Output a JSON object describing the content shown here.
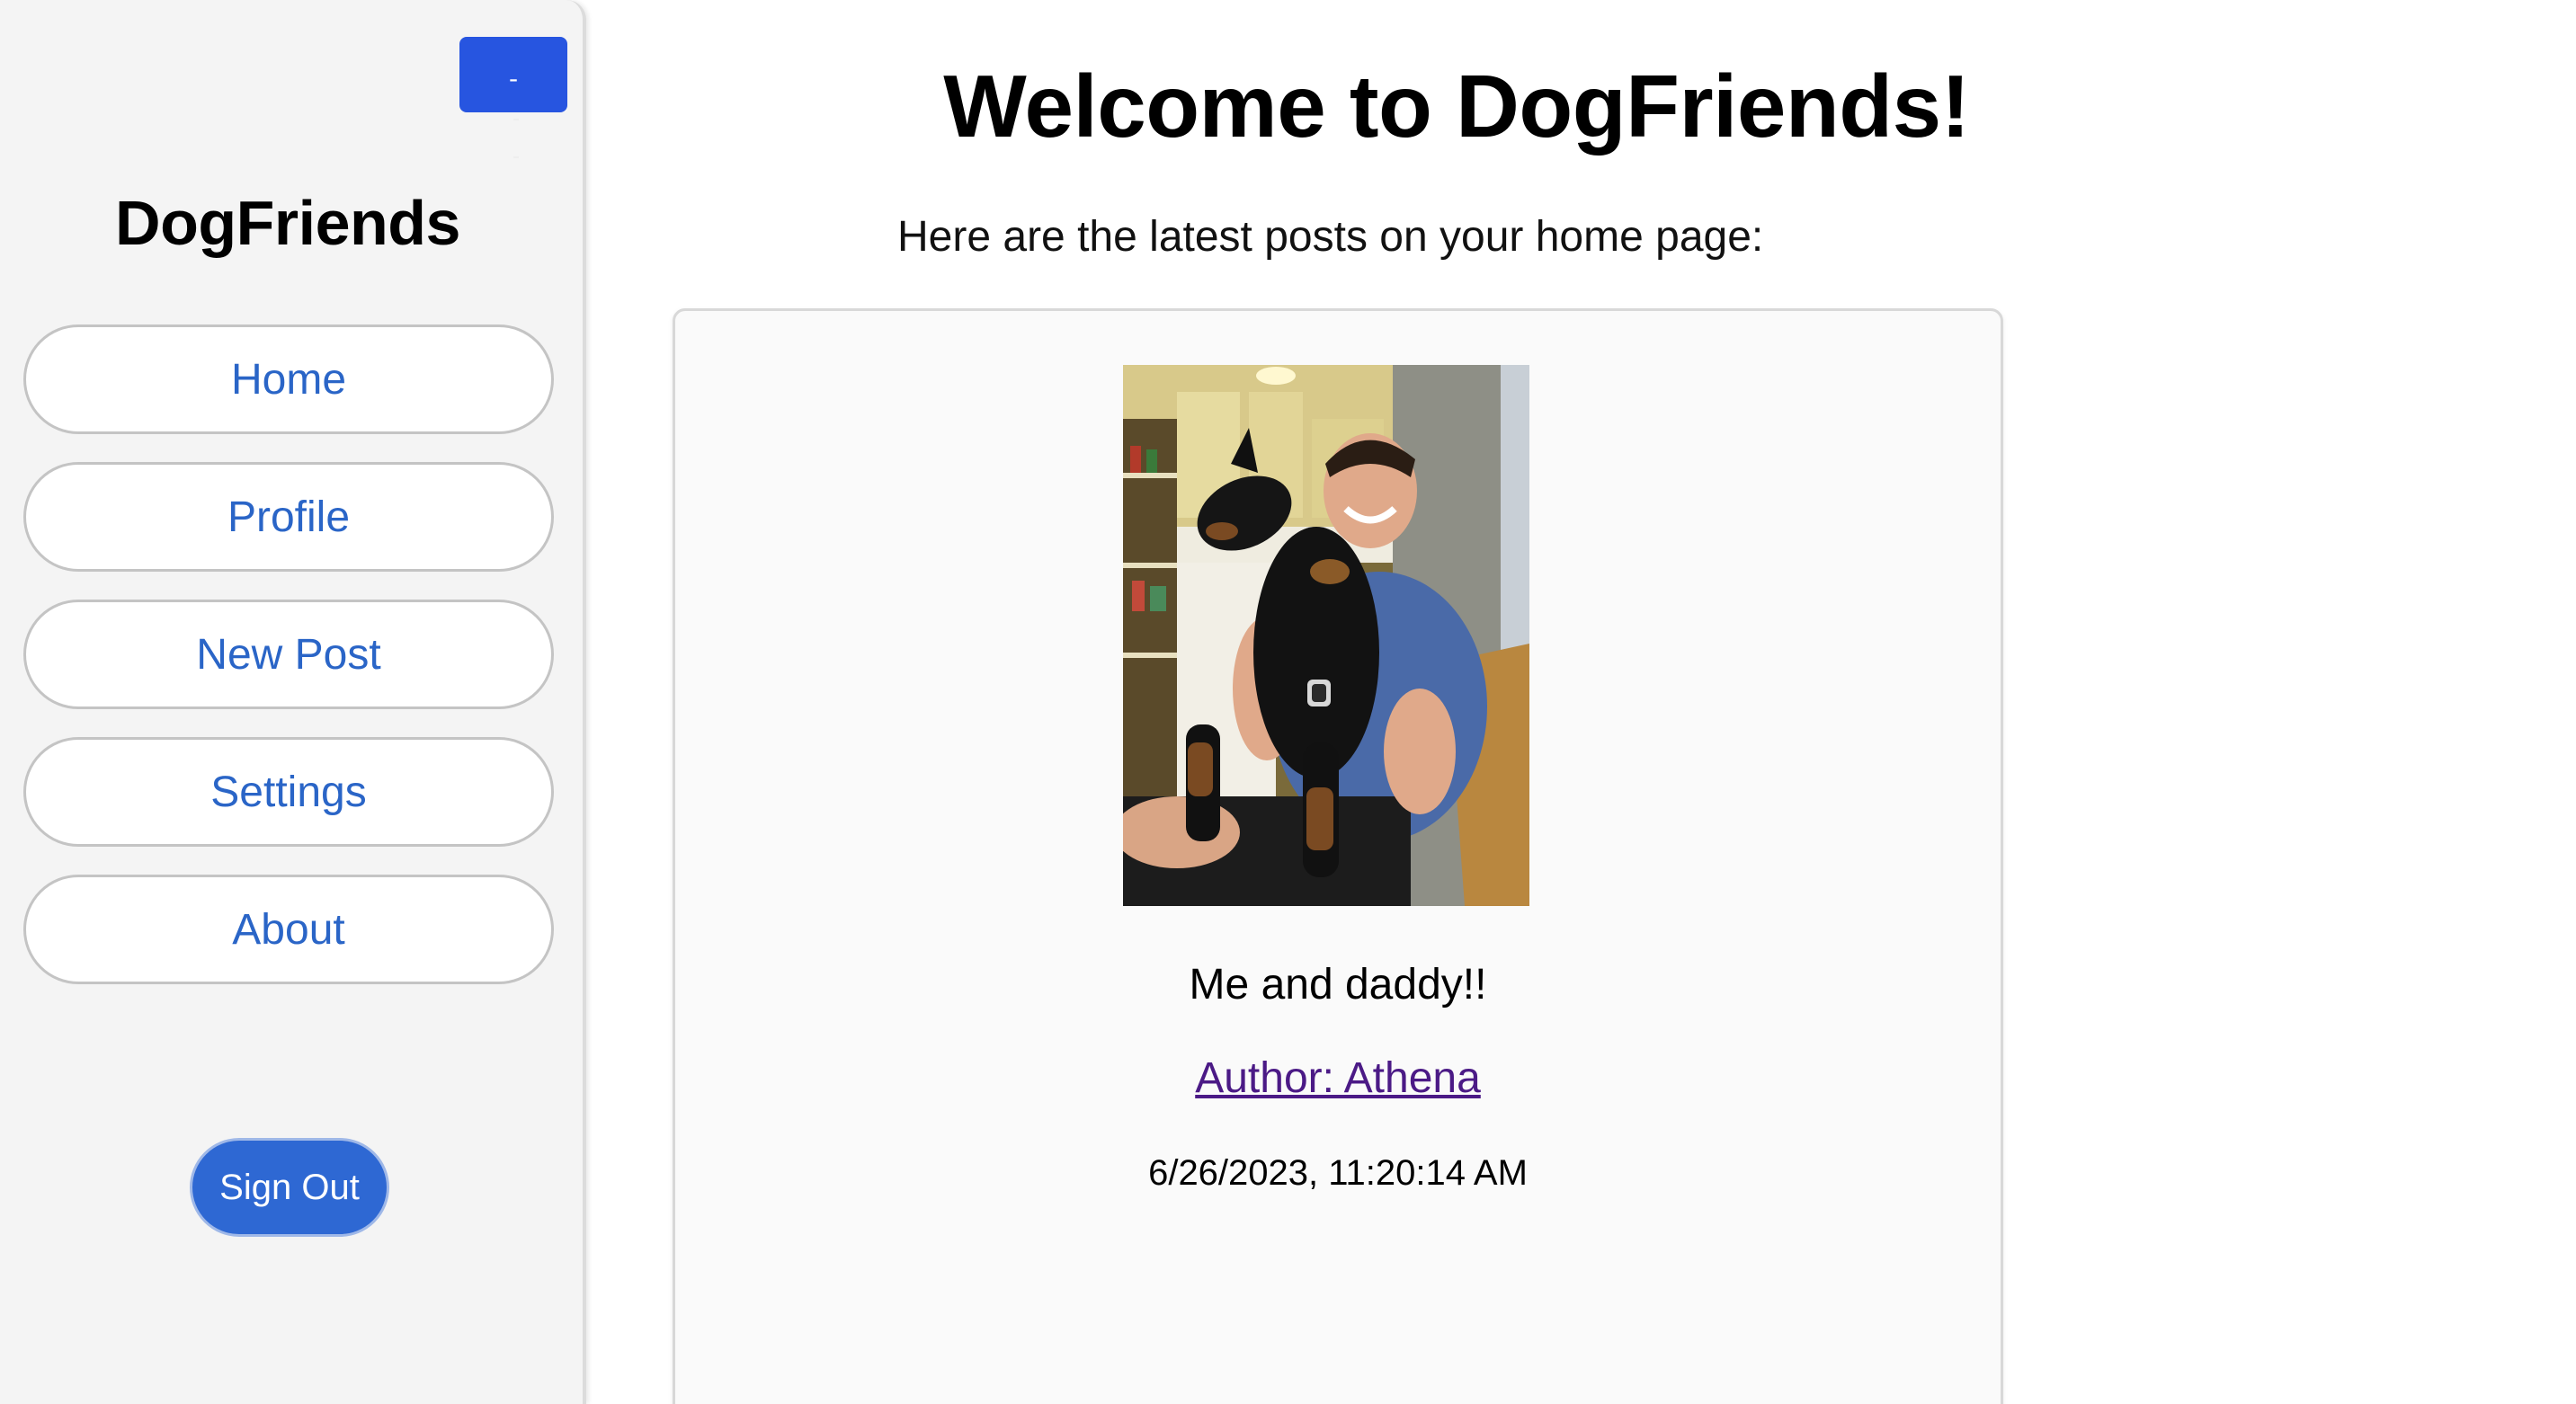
{
  "sidebar": {
    "collapse_label": "-",
    "brand": "DogFriends",
    "nav": [
      {
        "label": "Home"
      },
      {
        "label": "Profile"
      },
      {
        "label": "New Post"
      },
      {
        "label": "Settings"
      },
      {
        "label": "About"
      }
    ],
    "signout_label": "Sign Out"
  },
  "main": {
    "title": "Welcome to DogFriends!",
    "subtitle": "Here are the latest posts on your home page:",
    "posts": [
      {
        "image": "photo-man-holding-doberman-in-kitchen",
        "caption": "Me and daddy!!",
        "author": "Author: Athena",
        "timestamp": "6/26/2023, 11:20:14 AM"
      }
    ]
  },
  "colors": {
    "accent": "#2755e0",
    "nav_text": "#2a65c7",
    "signout_bg": "#2e68d3",
    "author_link": "#4b1a86",
    "sidebar_bg": "#f4f4f4"
  }
}
